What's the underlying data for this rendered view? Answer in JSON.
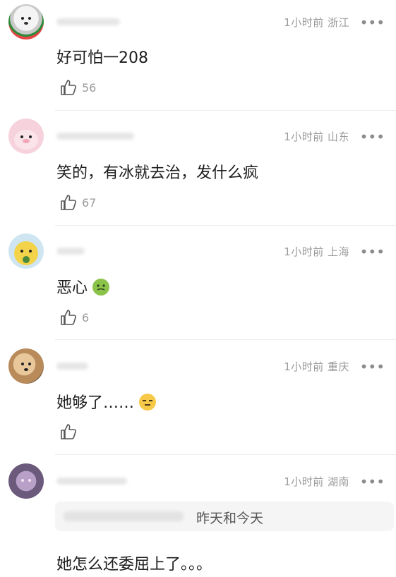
{
  "comments": [
    {
      "meta": "1小时前 浙江",
      "text": "好可怕一208",
      "likes": "56",
      "emoji": ""
    },
    {
      "meta": "1小时前 山东",
      "text": "笑的，有冰就去治，发什么疯",
      "likes": "67",
      "emoji": ""
    },
    {
      "meta": "1小时前 上海",
      "text": "恶心",
      "likes": "6",
      "emoji": "nauseated-face"
    },
    {
      "meta": "1小时前 重庆",
      "text": "她够了……",
      "likes": "",
      "emoji": "expressionless-face"
    },
    {
      "meta": "1小时前 湖南",
      "text": "她怎么还委屈上了。。。",
      "likes": "",
      "emoji": ""
    }
  ],
  "quote": {
    "text": "昨天和今天"
  },
  "more_label": "•••",
  "colors": {
    "meta": "#9a9a9a",
    "text": "#1d1d1d",
    "divider": "#ececec"
  }
}
